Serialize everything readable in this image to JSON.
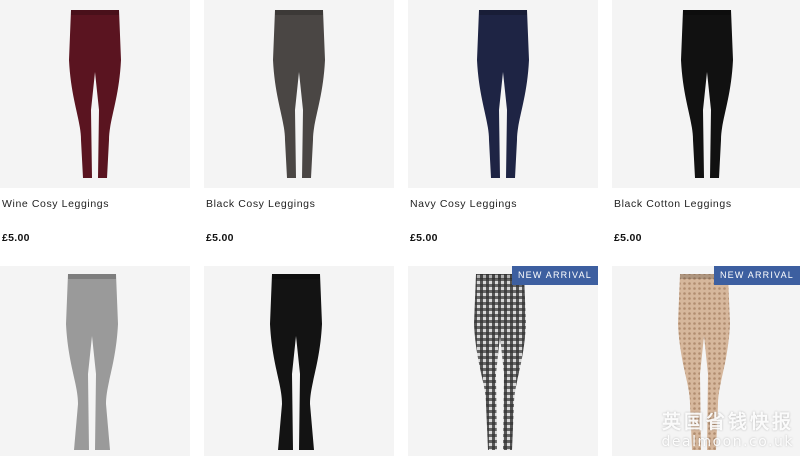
{
  "products": [
    {
      "name": "Wine Cosy Leggings",
      "price": "£5.00",
      "color": "#5a1420",
      "pattern": "solid"
    },
    {
      "name": "Black Cosy Leggings",
      "price": "£5.00",
      "color": "#4a4644",
      "pattern": "solid"
    },
    {
      "name": "Navy Cosy Leggings",
      "price": "£5.00",
      "color": "#1e2444",
      "pattern": "solid"
    },
    {
      "name": "Black Cotton Leggings",
      "price": "£5.00",
      "color": "#111111",
      "pattern": "solid"
    },
    {
      "name": "",
      "price": "",
      "color": "#9a9a9a",
      "pattern": "solid",
      "style": "flare"
    },
    {
      "name": "",
      "price": "",
      "color": "#131313",
      "pattern": "solid",
      "style": "flare"
    },
    {
      "name": "",
      "price": "",
      "color": "#6d6d6d",
      "pattern": "check",
      "badge": "NEW ARRIVAL"
    },
    {
      "name": "",
      "price": "",
      "color": "#c9a88c",
      "pattern": "knit",
      "badge": "NEW ARRIVAL"
    }
  ],
  "watermark": {
    "line1": "英国省钱快报",
    "line2": "dealmoon.co.uk"
  },
  "colors": {
    "badge": "#3d5fa0",
    "image_bg": "#f4f4f4"
  }
}
